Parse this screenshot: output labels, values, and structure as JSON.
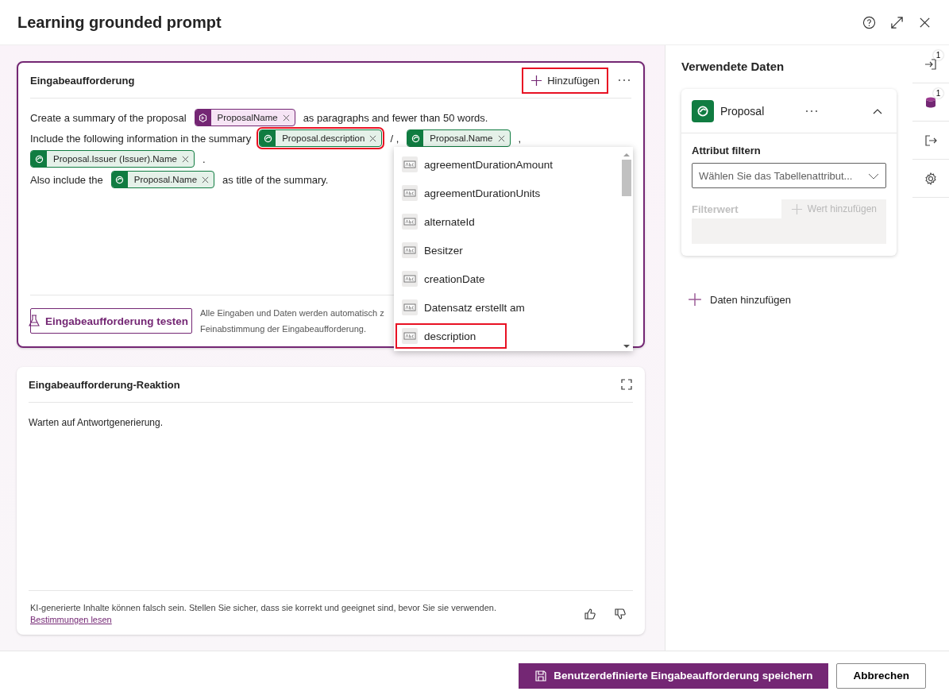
{
  "window": {
    "title": "Learning grounded prompt"
  },
  "prompt_card": {
    "title": "Eingabeaufforderung",
    "add_button": {
      "label": "Hinzufügen",
      "highlighted": true
    },
    "lines": [
      [
        {
          "kind": "text",
          "text": "Create a summary of the proposal"
        },
        {
          "kind": "input_chip",
          "text": "ProposalName",
          "highlighted": false
        },
        {
          "kind": "text",
          "text": "as paragraphs and fewer than 50 words."
        }
      ],
      [
        {
          "kind": "text",
          "text": "Include the following information in the summary"
        },
        {
          "kind": "data_chip",
          "text": "Proposal.description",
          "highlighted": true
        },
        {
          "kind": "text",
          "text": "/ ,"
        },
        {
          "kind": "data_chip",
          "text": "Proposal.Name",
          "highlighted": false
        },
        {
          "kind": "text",
          "text": ","
        }
      ],
      [
        {
          "kind": "data_chip",
          "text": "Proposal.Issuer (Issuer).Name",
          "highlighted": false
        },
        {
          "kind": "text",
          "text": "."
        }
      ],
      [
        {
          "kind": "text",
          "text": "Also include the"
        },
        {
          "kind": "data_chip",
          "text": "Proposal.Name",
          "highlighted": false
        },
        {
          "kind": "text",
          "text": "as title of the summary."
        }
      ]
    ],
    "test_button": "Eingabeaufforderung testen",
    "test_hint": [
      "Alle Eingaben und Daten werden automatisch z",
      "Feinabstimmung der Eingabeaufforderung."
    ],
    "dropdown": [
      {
        "label": "agreementDurationAmount",
        "highlighted": false
      },
      {
        "label": "agreementDurationUnits",
        "highlighted": false
      },
      {
        "label": "alternateId",
        "highlighted": false
      },
      {
        "label": "Besitzer",
        "highlighted": false
      },
      {
        "label": "creationDate",
        "highlighted": false
      },
      {
        "label": "Datensatz erstellt am",
        "highlighted": false
      },
      {
        "label": "description",
        "highlighted": true
      }
    ]
  },
  "response_card": {
    "title": "Eingabeaufforderung-Reaktion",
    "text": "Warten auf Antwortgenerierung.",
    "disclaimer": "KI-generierte Inhalte können falsch sein. Stellen Sie sicher, dass sie korrekt und geeignet sind, bevor Sie sie verwenden.",
    "link": "Bestimmungen lesen"
  },
  "data_panel": {
    "title": "Verwendete Daten",
    "source": {
      "name": "Proposal",
      "expanded": true
    },
    "filter_label": "Attribut filtern",
    "filter_placeholder": "Wählen Sie das Tabellenattribut...",
    "value_label": "Filterwert",
    "value_button": {
      "label": "Wert hinzufügen",
      "disabled": true
    },
    "add_data": "Daten hinzufügen"
  },
  "rail": [
    {
      "kind": "input",
      "badge": "1"
    },
    {
      "kind": "data",
      "badge": "1"
    },
    {
      "kind": "output"
    },
    {
      "kind": "settings"
    }
  ],
  "buttons": {
    "save": "Benutzerdefinierte Eingabeaufforderung speichern",
    "cancel": "Abbrechen"
  }
}
